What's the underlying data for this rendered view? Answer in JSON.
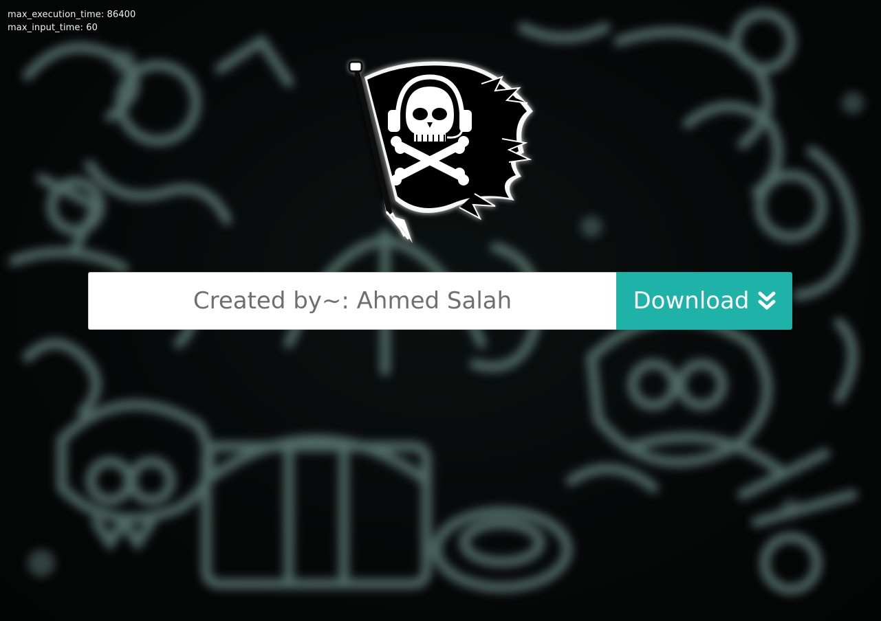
{
  "debug": {
    "line1": "max_execution_time: 86400",
    "line2": "max_input_time: 60"
  },
  "form": {
    "name_text": "Created by~: Ahmed Salah",
    "download_label": "Download"
  },
  "icons": {
    "logo": "pirate-skull-flag-icon",
    "download": "double-chevron-down-icon"
  },
  "colors": {
    "accent": "#1fb2a8",
    "background": "#050606",
    "doodle": "#6f8f86"
  }
}
